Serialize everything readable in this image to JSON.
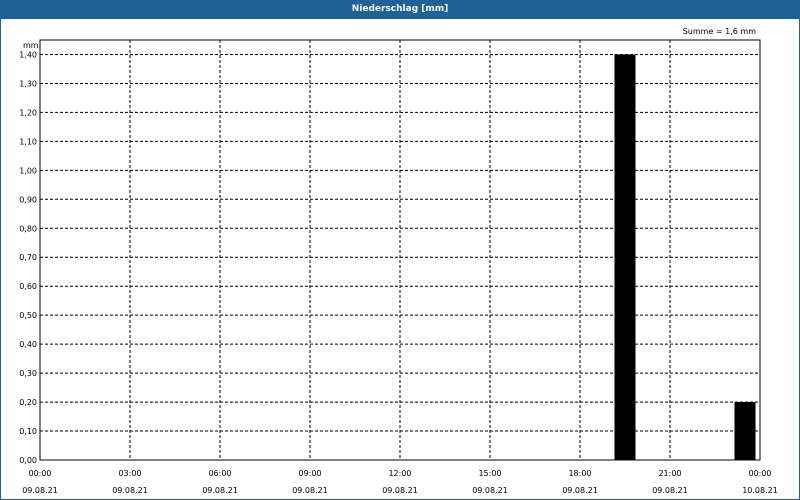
{
  "window": {
    "title": "Niederschlag [mm]"
  },
  "summary": "Summe = 1,6 mm",
  "chart_data": {
    "type": "bar",
    "title": "Niederschlag [mm]",
    "ylabel": "mm",
    "xlabel": "",
    "ylim": [
      0,
      1.45
    ],
    "y_ticks": [
      "0,00",
      "0,10",
      "0,20",
      "0,30",
      "0,40",
      "0,50",
      "0,60",
      "0,70",
      "0,80",
      "0,90",
      "1,00",
      "1,10",
      "1,20",
      "1,30",
      "1,40"
    ],
    "x_range_hours": [
      0,
      24
    ],
    "x_ticks": [
      {
        "time": "00:00",
        "date": "09.08.21"
      },
      {
        "time": "03:00",
        "date": "09.08.21"
      },
      {
        "time": "06:00",
        "date": "09.08.21"
      },
      {
        "time": "09:00",
        "date": "09.08.21"
      },
      {
        "time": "12:00",
        "date": "09.08.21"
      },
      {
        "time": "15:00",
        "date": "09.08.21"
      },
      {
        "time": "18:00",
        "date": "09.08.21"
      },
      {
        "time": "21:00",
        "date": "09.08.21"
      },
      {
        "time": "00:00",
        "date": "10.08.21"
      }
    ],
    "bars": [
      {
        "start": "09.08.21 19:00",
        "end": "09.08.21 20:00",
        "value": 1.4
      },
      {
        "start": "09.08.21 23:00",
        "end": "10.08.21 00:00",
        "value": 0.2
      }
    ],
    "bar_color": "#000000",
    "grid": true
  }
}
